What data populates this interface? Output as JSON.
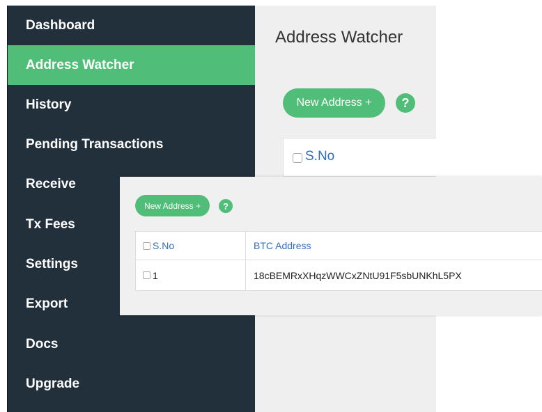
{
  "sidebar": {
    "items": [
      {
        "label": "Dashboard",
        "active": false
      },
      {
        "label": "Address Watcher",
        "active": true
      },
      {
        "label": "History",
        "active": false
      },
      {
        "label": "Pending Transactions",
        "active": false
      },
      {
        "label": "Receive",
        "active": false
      },
      {
        "label": "Tx Fees",
        "active": false
      },
      {
        "label": "Settings",
        "active": false
      },
      {
        "label": "Export",
        "active": false
      },
      {
        "label": "Docs",
        "active": false
      },
      {
        "label": "Upgrade",
        "active": false
      }
    ]
  },
  "main": {
    "title": "Address Watcher",
    "new_address_label": "New Address +",
    "help_glyph": "?",
    "table_header_sno": "S.No"
  },
  "overlay": {
    "new_address_label": "New Address +",
    "help_glyph": "?",
    "table": {
      "columns": [
        "S.No",
        "BTC Address"
      ],
      "rows": [
        {
          "sno": "1",
          "address": "18cBEMRxXHqzWWCxZNtU91F5sbUNKhL5PX"
        }
      ]
    }
  },
  "colors": {
    "sidebar_bg": "#22303c",
    "accent_green": "#50bd79",
    "link_blue": "#2f6fbf",
    "panel_bg": "#efefef"
  }
}
